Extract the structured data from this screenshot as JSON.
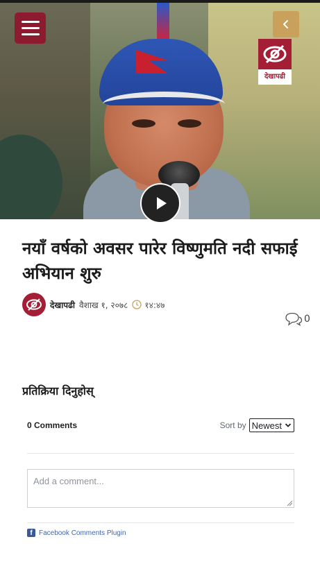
{
  "article": {
    "title": "नयाँ वर्षको अवसर पारेर विष्णुमति नदी सफाई अभियान शुरु",
    "author": "देखापढी",
    "date": "वैशाख १, २०७८",
    "time": "१४:४७",
    "comment_count": "0"
  },
  "brand": {
    "logo_text": "देखापढी",
    "accent": "#a41e35",
    "gold": "#c9a15c"
  },
  "icons": {
    "menu": "hamburger-menu-icon",
    "back": "chevron-left-icon",
    "play": "play-icon",
    "clock": "clock-icon",
    "comment": "speech-bubble-icon",
    "facebook": "facebook-icon"
  },
  "comments_section": {
    "heading": "प्रतिक्रिया दिनुहोस्",
    "count_label": "0 Comments",
    "sort_label": "Sort by",
    "sort_value": "Newest",
    "placeholder": "Add a comment...",
    "plugin_label": "Facebook Comments Plugin"
  }
}
